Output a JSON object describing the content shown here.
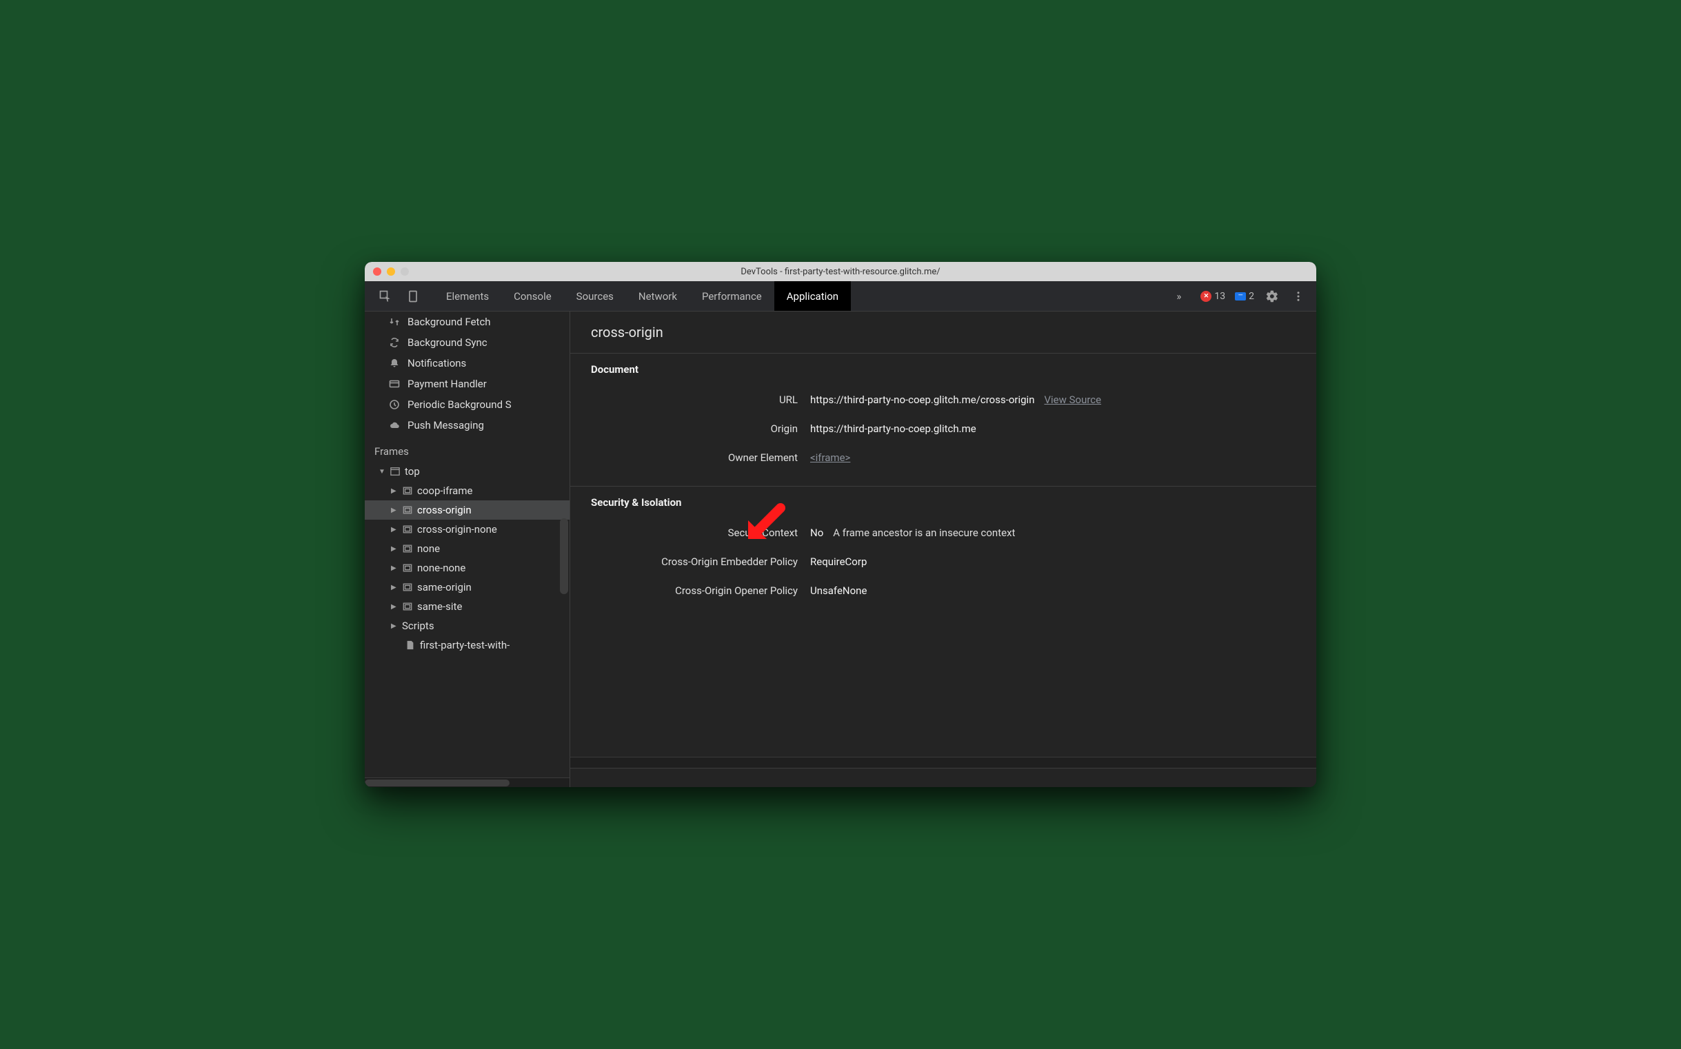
{
  "titlebar": {
    "title": "DevTools - first-party-test-with-resource.glitch.me/"
  },
  "tabs": {
    "items": [
      "Elements",
      "Console",
      "Sources",
      "Network",
      "Performance",
      "Application"
    ],
    "active_index": 5,
    "overflow_glyph": "»"
  },
  "status": {
    "errors": "13",
    "messages": "2"
  },
  "sidebar": {
    "bg_services": [
      {
        "icon": "fetch-icon",
        "label": "Background Fetch"
      },
      {
        "icon": "sync-icon",
        "label": "Background Sync"
      },
      {
        "icon": "bell-icon",
        "label": "Notifications"
      },
      {
        "icon": "card-icon",
        "label": "Payment Handler"
      },
      {
        "icon": "clock-icon",
        "label": "Periodic Background S"
      },
      {
        "icon": "cloud-icon",
        "label": "Push Messaging"
      }
    ],
    "frames_label": "Frames",
    "frames": {
      "top_label": "top",
      "children": [
        "coop-iframe",
        "cross-origin",
        "cross-origin-none",
        "none",
        "none-none",
        "same-origin",
        "same-site"
      ],
      "selected_index": 1,
      "scripts_label": "Scripts",
      "script_file": "first-party-test-with-"
    }
  },
  "main": {
    "heading": "cross-origin",
    "document": {
      "section_title": "Document",
      "url_label": "URL",
      "url_value": "https://third-party-no-coep.glitch.me/cross-origin",
      "view_source": "View Source",
      "origin_label": "Origin",
      "origin_value": "https://third-party-no-coep.glitch.me",
      "owner_label": "Owner Element",
      "owner_value": "<iframe>"
    },
    "security": {
      "section_title": "Security & Isolation",
      "secure_context_label": "Secure Context",
      "secure_context_value": "No",
      "secure_context_note": "A frame ancestor is an insecure context",
      "coep_label": "Cross-Origin Embedder Policy",
      "coep_value": "RequireCorp",
      "coop_label": "Cross-Origin Opener Policy",
      "coop_value": "UnsafeNone"
    }
  }
}
